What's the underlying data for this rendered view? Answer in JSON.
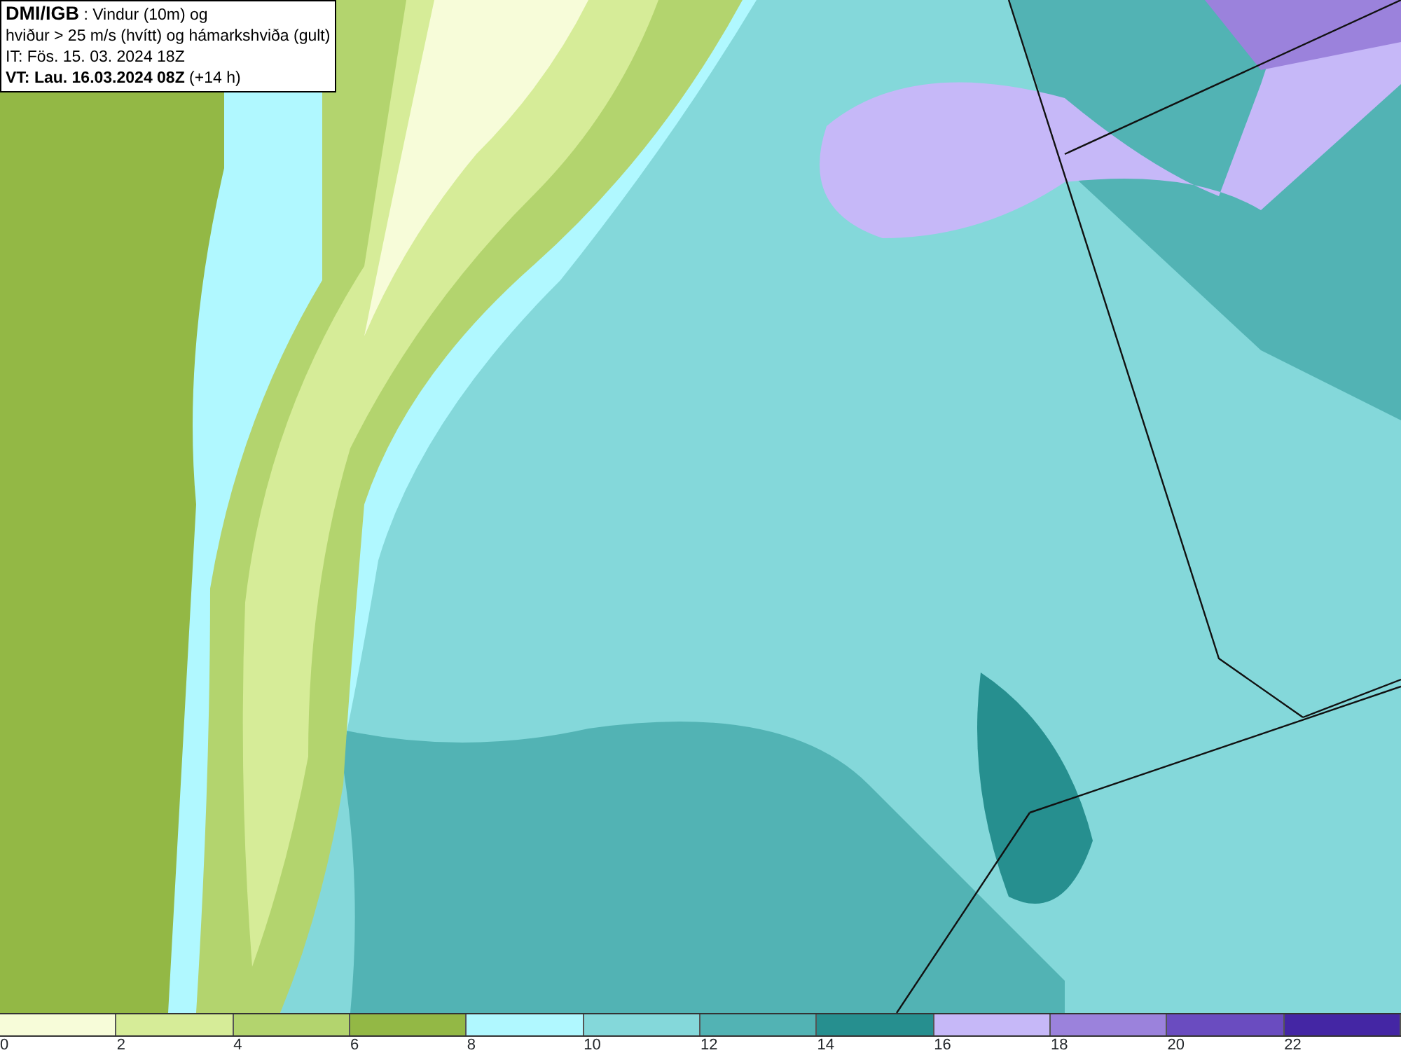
{
  "info_box": {
    "lines": [
      "**DMI/IGB** : Vindur (10m) og",
      "hviður > 25 m/s (hvítt) og hámarkshviða (gult)",
      "IT: Fös. 15. 03. 2024 18Z",
      "**VT: Lau. 16.03.2024 08Z** (+14 h)"
    ]
  },
  "legend": [
    {
      "label": "0",
      "color": "#f7fcd9"
    },
    {
      "label": "2",
      "color": "#d6ec98"
    },
    {
      "label": "4",
      "color": "#b3d46e"
    },
    {
      "label": "6",
      "color": "#93b845"
    },
    {
      "label": "8",
      "color": "#b0f8ff"
    },
    {
      "label": "10",
      "color": "#84d8da"
    },
    {
      "label": "12",
      "color": "#52b3b4"
    },
    {
      "label": "14",
      "color": "#268f8f"
    },
    {
      "label": "16",
      "color": "#c6b8f8"
    },
    {
      "label": "18",
      "color": "#9b82dc"
    },
    {
      "label": "20",
      "color": "#6a4cc0"
    },
    {
      "label": "22",
      "color": "#4426a4"
    }
  ]
}
